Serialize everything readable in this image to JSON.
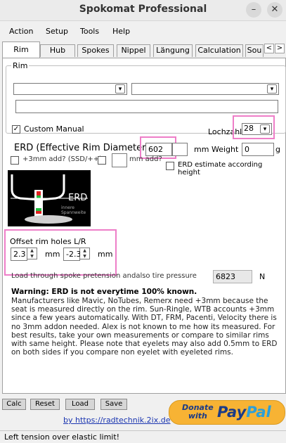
{
  "window": {
    "title": "Spokomat Professional",
    "minimize": "–",
    "close": "✕"
  },
  "menu": [
    "Action",
    "Setup",
    "Tools",
    "Help"
  ],
  "tabs": [
    "Rim",
    "Hub",
    "Spokes",
    "Nippel",
    "Längung",
    "Calculation",
    "Sou"
  ],
  "tab_arrows": [
    "<",
    ">"
  ],
  "rim": {
    "group_label": "Rim",
    "combo1": "",
    "combo2": "",
    "description": "",
    "custom_manual_label": "Custom Manual",
    "custom_manual_checked": true,
    "lochzahl_label": "Lochzahl",
    "lochzahl_value": "28",
    "erd_label": "ERD (Effective Rim Diameter)",
    "erd_value": "602",
    "erd_extra": "",
    "erd_unit": "mm",
    "weight_label": "Weight",
    "weight_value": "0",
    "weight_unit": "g",
    "add3mm_label": "+3mm add? (SSD/++)",
    "mm_add_label": "mm add?",
    "erd_estimate_label": "ERD estimate according height",
    "offset_label": "Offset rim holes L/R",
    "offset_left": "2.3",
    "offset_right": "-2.3",
    "offset_unit": "mm",
    "load_label": "Load through spoke pretension andalso tire pressure",
    "load_value": "6823",
    "load_unit": "N",
    "warning_title": "Warning: ERD is not everytime 100% known.",
    "warning_text": "Manufacturers like Mavic, NoTubes, Remerx need +3mm because the seat is measured directly on the rim. Sun-Ringle, WTB accounts +3mm since a few years automatically. With DT, FRM, Pacenti, Velocity there is no 3mm addon needed. Alex is not known to me how its measured. For best results, take your own measurements or compare to similar rims with same height. Please note that eyelets may also add 0.5mm to ERD on both sides if you compare non eyelet with eyeleted rims."
  },
  "diagram": {
    "label": "ERD",
    "sublabel": "innere Spannweite"
  },
  "buttons": [
    "Calc",
    "Reset",
    "Load",
    "Save"
  ],
  "donate": {
    "line1": "Donate",
    "line2": "with",
    "brand1": "Pay",
    "brand2": "Pal"
  },
  "credit_link": "by https://radtechnik.2ix.de",
  "status": "Left tension over elastic limit!",
  "colors": {
    "highlight": "#ee7ec8",
    "paypal_blue": "#1b3b87",
    "paypal_light": "#2c9fd9",
    "donate_gold": "#f7b334"
  }
}
